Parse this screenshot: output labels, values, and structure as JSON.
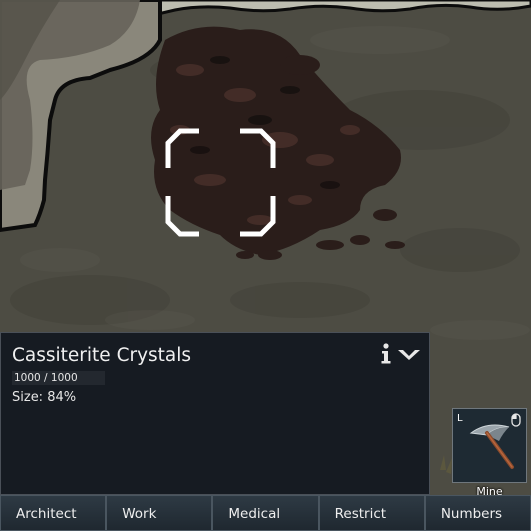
{
  "inspect": {
    "title": "Cassiterite Crystals",
    "hit_points_text": "1000 / 1000",
    "hit_points_fraction": 1.0,
    "size_text": "Size: 84%"
  },
  "command": {
    "hotkey": "L",
    "label": "Mine",
    "icon": "pickaxe-icon"
  },
  "main_tabs": [
    {
      "label": "Architect"
    },
    {
      "label": "Work"
    },
    {
      "label": "Medical"
    },
    {
      "label": "Restrict"
    },
    {
      "label": "Numbers"
    }
  ],
  "colors": {
    "panel_bg": "#161b22",
    "tab_bg": "#26313a",
    "rock": "#4b4a42",
    "ore": "#2a1d1a",
    "selection": "#ffffff"
  }
}
